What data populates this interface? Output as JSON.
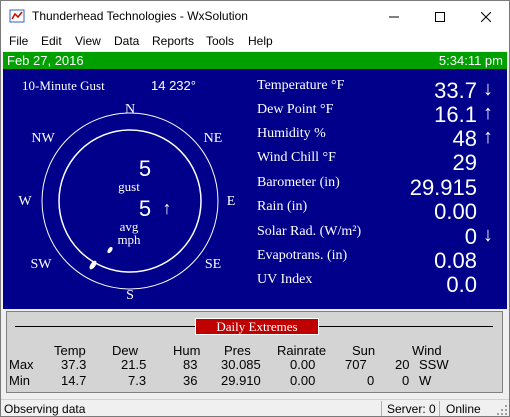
{
  "window": {
    "title": "Thunderhead Technologies - WxSolution"
  },
  "menu": [
    "File",
    "Edit",
    "View",
    "Data",
    "Reports",
    "Tools",
    "Help"
  ],
  "header_bar": {
    "date": "Feb 27, 2016",
    "time": "5:34:11 pm"
  },
  "gust_header": {
    "label": "10-Minute Gust",
    "value": "14 232°"
  },
  "compass": {
    "directions": [
      "N",
      "NE",
      "E",
      "SE",
      "S",
      "SW",
      "W",
      "NW"
    ],
    "gust_value": "5",
    "gust_label": "gust",
    "avg_value": "5",
    "avg_arrow": "↑",
    "avg_label": "avg",
    "mph_label": "mph"
  },
  "readings": [
    {
      "label": "Temperature °F",
      "value": "33.7",
      "arrow": "↓"
    },
    {
      "label": "Dew Point °F",
      "value": "16.1",
      "arrow": "↑"
    },
    {
      "label": "Humidity %",
      "value": "48",
      "arrow": "↑"
    },
    {
      "label": "Wind Chill  °F",
      "value": "29",
      "arrow": ""
    },
    {
      "label": "Barometer (in)",
      "value": "29.915",
      "arrow": ""
    },
    {
      "label": "Rain (in)",
      "value": "0.00",
      "arrow": ""
    },
    {
      "label": "Solar Rad. (W/m²)",
      "value": "0",
      "arrow": "↓"
    },
    {
      "label": "Evapotrans. (in)",
      "value": "0.08",
      "arrow": ""
    },
    {
      "label": "UV Index",
      "value": "0.0",
      "arrow": ""
    }
  ],
  "extremes": {
    "title": "Daily Extremes",
    "headers": [
      "Temp",
      "Dew",
      "Hum",
      "Pres",
      "Rainrate",
      "Sun",
      "Wind"
    ],
    "rows": [
      {
        "label": "Max",
        "temp": "37.3",
        "dew": "21.5",
        "hum": "83",
        "pres": "30.085",
        "rainrate": "0.00",
        "sun": "707",
        "wind_speed": "20",
        "wind_dir": "SSW"
      },
      {
        "label": "Min",
        "temp": "14.7",
        "dew": "7.3",
        "hum": "36",
        "pres": "29.910",
        "rainrate": "0.00",
        "sun": "0",
        "wind_speed": "0",
        "wind_dir": "W"
      }
    ]
  },
  "statusbar": {
    "status": "Observing data",
    "server": "Server: 0",
    "connection": "Online"
  },
  "colors": {
    "panel": "#00008b",
    "date_bar": "#00a000",
    "extremes_title": "#c00000"
  }
}
